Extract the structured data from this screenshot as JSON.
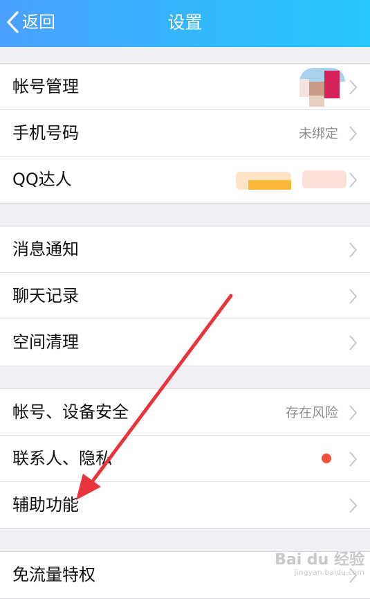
{
  "nav": {
    "back_label": "返回",
    "title": "设置"
  },
  "sections": [
    [
      {
        "label": "帐号管理",
        "value": ""
      },
      {
        "label": "手机号码",
        "value": "未绑定"
      },
      {
        "label": "QQ达人",
        "value": ""
      }
    ],
    [
      {
        "label": "消息通知",
        "value": ""
      },
      {
        "label": "聊天记录",
        "value": ""
      },
      {
        "label": "空间清理",
        "value": ""
      }
    ],
    [
      {
        "label": "帐号、设备安全",
        "value": "存在风险"
      },
      {
        "label": "联系人、隐私",
        "value": ""
      },
      {
        "label": "辅助功能",
        "value": ""
      }
    ],
    [
      {
        "label": "免流量特权",
        "value": ""
      }
    ]
  ],
  "colors": {
    "nav_start": "#4aa1ff",
    "nav_end": "#27c6ff",
    "badge_dot": "#f0533a",
    "arrow": "#e8353b"
  },
  "icons": {
    "back": "chevron-left-icon",
    "disclosure": "chevron-right-icon"
  },
  "watermark": {
    "main": "Bai du 经验",
    "sub": "jingyan.baidu.com"
  }
}
